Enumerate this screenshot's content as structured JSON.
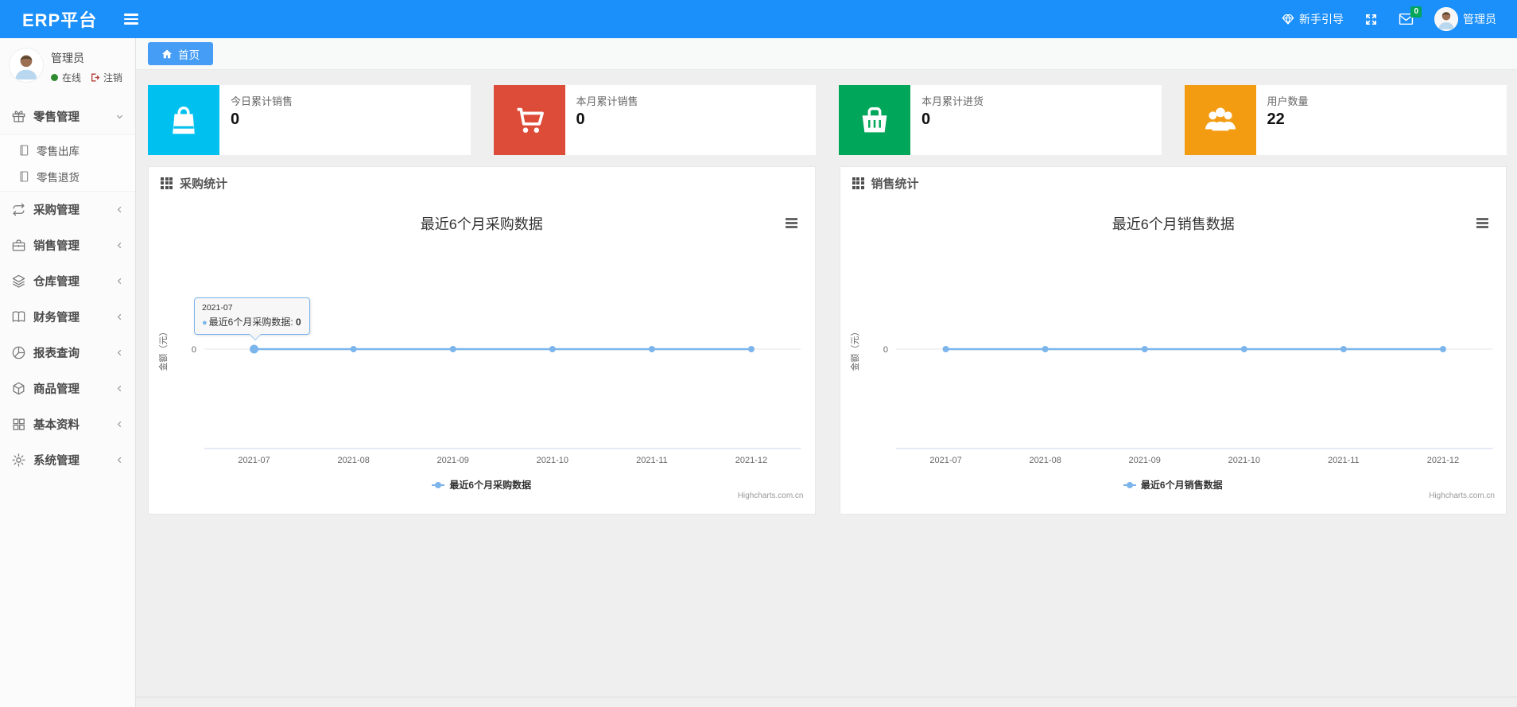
{
  "navbar": {
    "brand": "ERP平台",
    "guide_label": "新手引导",
    "badge_count": "0",
    "username": "管理员"
  },
  "sidebar": {
    "username": "管理员",
    "status_online": "在线",
    "logout_label": "注销",
    "menu": [
      {
        "label": "零售管理",
        "icon": "gift-icon",
        "expanded": true,
        "children": [
          {
            "label": "零售出库",
            "icon": "journal-icon"
          },
          {
            "label": "零售退货",
            "icon": "journal-icon"
          }
        ]
      },
      {
        "label": "采购管理",
        "icon": "repeat-icon"
      },
      {
        "label": "销售管理",
        "icon": "briefcase-icon"
      },
      {
        "label": "仓库管理",
        "icon": "layers-icon"
      },
      {
        "label": "财务管理",
        "icon": "book-icon"
      },
      {
        "label": "报表查询",
        "icon": "pie-chart-icon"
      },
      {
        "label": "商品管理",
        "icon": "cube-icon"
      },
      {
        "label": "基本资料",
        "icon": "grid-icon"
      },
      {
        "label": "系统管理",
        "icon": "gear-icon"
      }
    ]
  },
  "tabs": {
    "home": "首页"
  },
  "cards": [
    {
      "label": "今日累计销售",
      "value": "0",
      "color": "#00c0ef",
      "icon": "shopping-bag-icon"
    },
    {
      "label": "本月累计销售",
      "value": "0",
      "color": "#dd4b39",
      "icon": "cart-icon"
    },
    {
      "label": "本月累计进货",
      "value": "0",
      "color": "#00a65a",
      "icon": "basket-icon"
    },
    {
      "label": "用户数量",
      "value": "22",
      "color": "#f39c12",
      "icon": "users-icon"
    }
  ],
  "panels": [
    {
      "header": "采购统计"
    },
    {
      "header": "销售统计"
    }
  ],
  "chart_data": [
    {
      "type": "line",
      "title": "最近6个月采购数据",
      "categories": [
        "2021-07",
        "2021-08",
        "2021-09",
        "2021-10",
        "2021-11",
        "2021-12"
      ],
      "series": [
        {
          "name": "最近6个月采购数据",
          "values": [
            0,
            0,
            0,
            0,
            0,
            0
          ]
        }
      ],
      "xlabel": "",
      "ylabel": "金额（元）",
      "yticks": [
        "0"
      ],
      "ylim": [
        0,
        1
      ],
      "grid": "horizontal-zero-line",
      "legend_position": "bottom",
      "line_color": "#7cb5ec",
      "axis_line_color": "#ccd6eb",
      "credits": "Highcharts.com.cn",
      "tooltip": {
        "header": "2021-07",
        "series_label": "最近6个月采购数据: ",
        "value": "0",
        "point_index": 0
      }
    },
    {
      "type": "line",
      "title": "最近6个月销售数据",
      "categories": [
        "2021-07",
        "2021-08",
        "2021-09",
        "2021-10",
        "2021-11",
        "2021-12"
      ],
      "series": [
        {
          "name": "最近6个月销售数据",
          "values": [
            0,
            0,
            0,
            0,
            0,
            0
          ]
        }
      ],
      "xlabel": "",
      "ylabel": "金额（元）",
      "yticks": [
        "0"
      ],
      "ylim": [
        0,
        1
      ],
      "grid": "horizontal-zero-line",
      "legend_position": "bottom",
      "line_color": "#7cb5ec",
      "axis_line_color": "#ccd6eb",
      "credits": "Highcharts.com.cn"
    }
  ]
}
